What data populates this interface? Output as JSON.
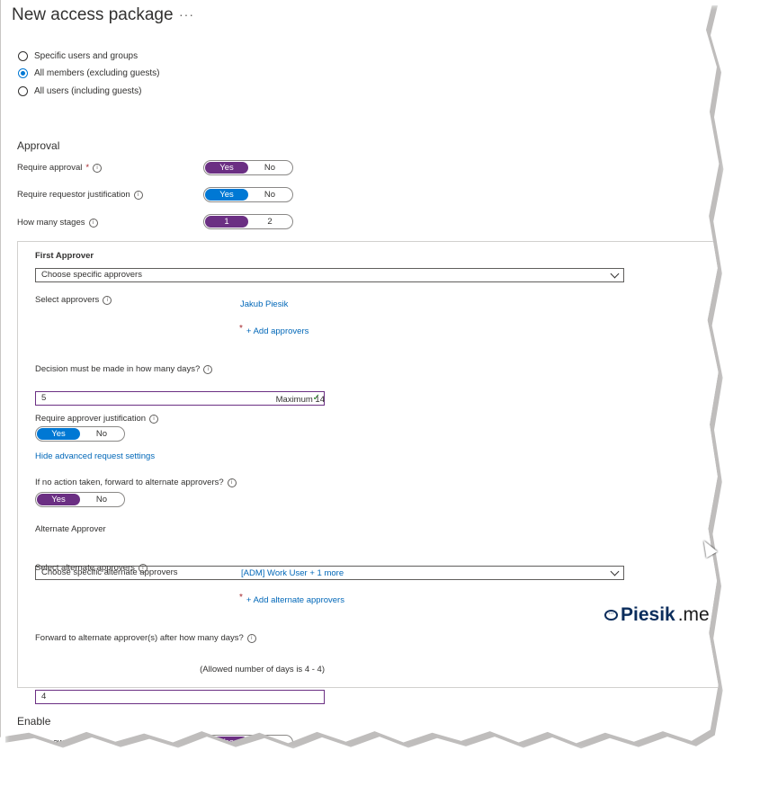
{
  "header": {
    "title": "New access package",
    "more": "···"
  },
  "scope": {
    "options": [
      {
        "label": "Specific users and groups",
        "selected": false
      },
      {
        "label": "All members (excluding guests)",
        "selected": true
      },
      {
        "label": "All users (including guests)",
        "selected": false
      }
    ]
  },
  "approval": {
    "heading": "Approval",
    "require_approval": {
      "label": "Require approval",
      "required_mark": "*",
      "yes": "Yes",
      "no": "No",
      "value": "Yes"
    },
    "require_justification": {
      "label": "Require requestor justification",
      "yes": "Yes",
      "no": "No",
      "value": "Yes"
    },
    "stages": {
      "label": "How many stages",
      "one": "1",
      "two": "2",
      "value": "1"
    }
  },
  "first_approver": {
    "heading": "First Approver",
    "dropdown_value": "Choose specific approvers",
    "select_label": "Select approvers",
    "selected_approver": "Jakub Piesik",
    "required_mark": "*",
    "add_link": "+ Add approvers",
    "decision_label": "Decision must be made in how many days?",
    "decision_value": "5",
    "decision_hint": "Maximum 14",
    "justification_label": "Require approver justification",
    "justification_yes": "Yes",
    "justification_no": "No",
    "hide_advanced": "Hide advanced request settings",
    "forward_label": "If no action taken, forward to alternate approvers?",
    "forward_yes": "Yes",
    "forward_no": "No"
  },
  "alternate_approver": {
    "heading": "Alternate Approver",
    "dropdown_value": "Choose specific alternate approvers",
    "select_label": "Select alternate approvers",
    "selected_approvers": "[ADM] Work User + 1 more",
    "required_mark": "*",
    "add_link": "+ Add alternate approvers",
    "forward_days_label": "Forward to alternate approver(s) after how many days?",
    "forward_days_value": "4",
    "forward_days_hint": "(Allowed number of days is 4 - 4)"
  },
  "enable": {
    "heading": "Enable",
    "label_fragment": "ew",
    "yes": "Yes",
    "no": "No"
  },
  "watermark": {
    "brand": "Piesik",
    "suffix": ".me"
  },
  "colors": {
    "accent_purple": "#6b2f83",
    "accent_blue": "#0078d4",
    "link": "#0067b8"
  }
}
